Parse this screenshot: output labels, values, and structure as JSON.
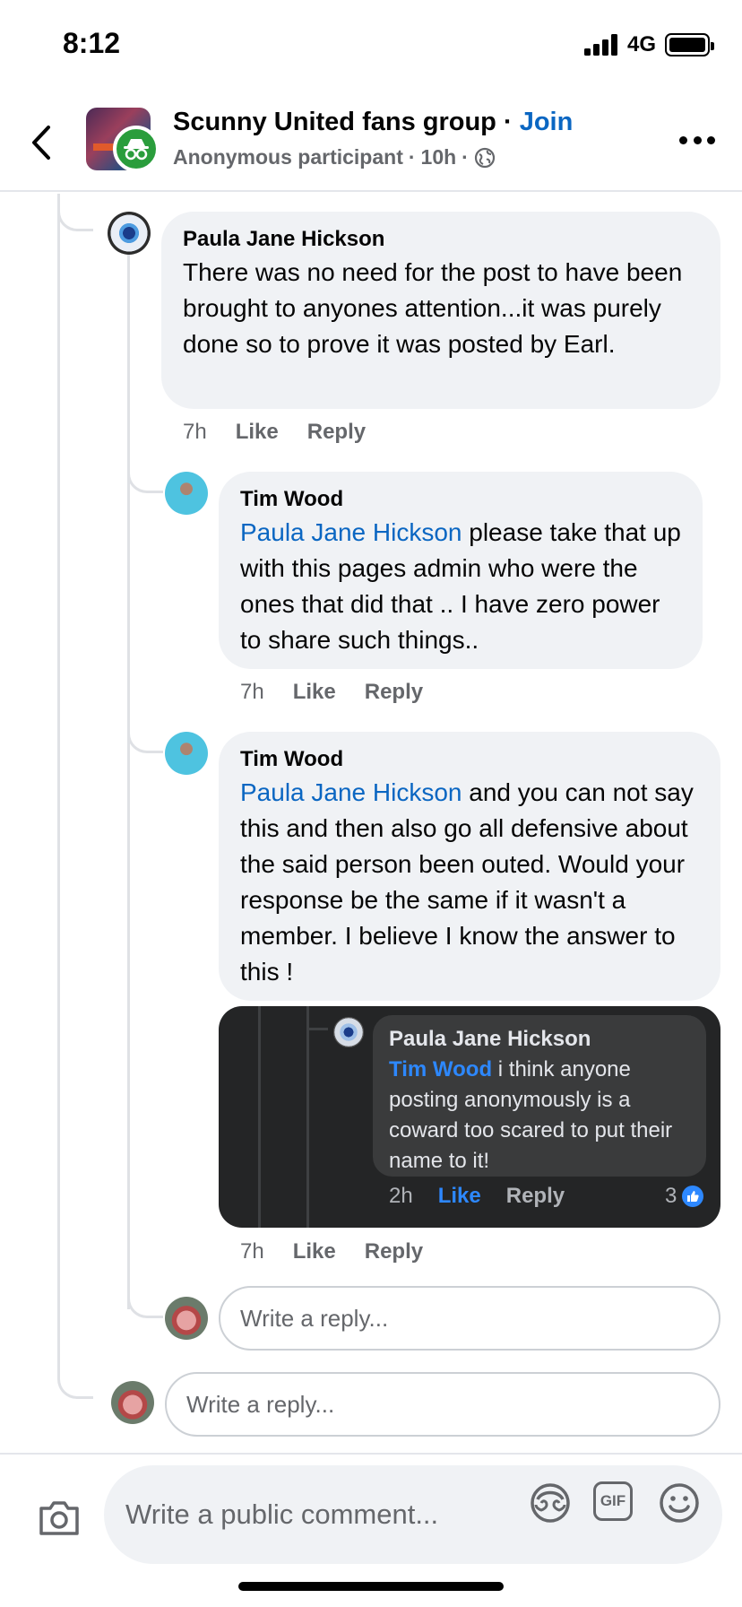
{
  "status_bar": {
    "time": "8:12",
    "network": "4G"
  },
  "header": {
    "group_name": "Scunny United fans group",
    "separator": " · ",
    "join_label": "Join",
    "poster": "Anonymous participant",
    "age": "10h",
    "dot": "·"
  },
  "comments": [
    {
      "author": "Paula Jane Hickson",
      "mention": "",
      "text": "There was no need for the post to have been brought to anyones attention...it was purely done so to prove it was posted by Earl.",
      "time": "7h",
      "like": "Like",
      "reply": "Reply"
    },
    {
      "author": "Tim Wood",
      "mention": "Paula Jane Hickson",
      "text": " please take that up with this pages admin who were the ones that did that .. I have zero power to share such things..",
      "time": "7h",
      "like": "Like",
      "reply": "Reply"
    },
    {
      "author": "Tim Wood",
      "mention": "Paula Jane Hickson",
      "text": " and you can not say this and then also go all defensive about the said person been outed. Would your response  be the same if it wasn't a member. I believe I know the answer to this !",
      "time": "7h",
      "like": "Like",
      "reply": "Reply"
    }
  ],
  "embedded": {
    "author": "Paula Jane Hickson",
    "mention": "Tim Wood",
    "text": " i think anyone posting anonymously is a coward too scared to put their name to it!",
    "time": "2h",
    "like": "Like",
    "reply": "Reply",
    "reaction_count": "3"
  },
  "reply_placeholder": "Write a reply...",
  "composer": {
    "placeholder": "Write a public comment...",
    "gif_label": "GIF"
  },
  "colors": {
    "link": "#0a66c2",
    "bubble": "#f0f2f5",
    "dark_card": "#242526"
  }
}
